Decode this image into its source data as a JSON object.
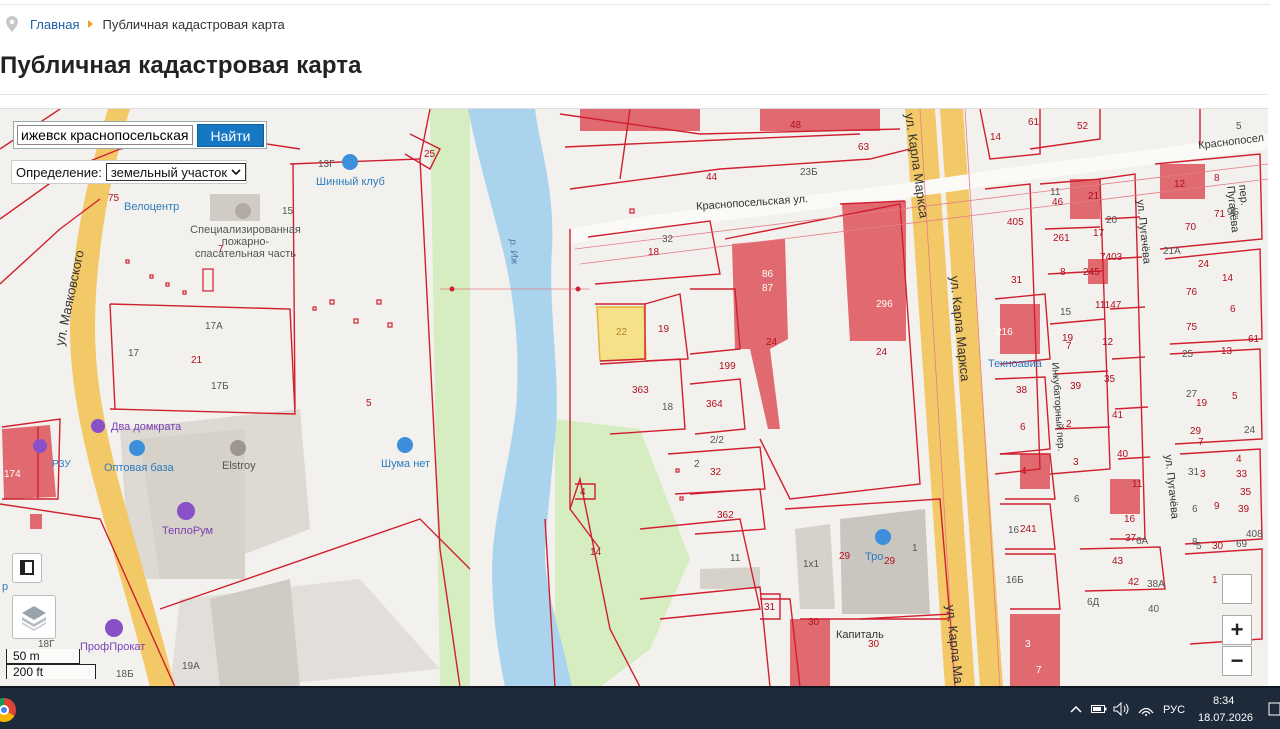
{
  "breadcrumb": {
    "home": "Главная",
    "current": "Публичная кадастровая карта"
  },
  "page_title": "Публичная кадастровая карта",
  "search": {
    "value": "ижевск краснопосельская 22",
    "button": "Найти"
  },
  "definition": {
    "label": "Определение:",
    "selected": "земельный участок"
  },
  "map_labels": {
    "street_marx_1": "ул. Карла Маркса",
    "street_marx_2": "ул. Карла Маркса",
    "street_marx_3": "ул. Карла Ма",
    "street_maiakovskogo": "ул. Маяковского",
    "street_krasnoposelskaya": "Краснопосельская ул.",
    "street_krasnoposel_right": "Краснопосел",
    "street_pugacheva": "ул. Пугачёва",
    "street_pugacheva_2": "ул. Пугачёва",
    "street_pugacheva_3": "пер. Пугачёва",
    "pereulok_inkubator": "Инкубаторный пер.",
    "river": "р. Иж",
    "poi_shinny": "Шинный клуб",
    "poi_velocentr": "Велоцентр",
    "poi_fire": "Специализированная пожарно-спасательная часть",
    "poi_dva_domkrata": "Два домкрата",
    "poi_optovaya": "Оптовая база",
    "poi_elstroy": "Elstroy",
    "poi_shuma": "Шума нет",
    "poi_teplorum": "ТеплоРум",
    "poi_profprokat": "ПрофПрокат",
    "poi_tehnoavia": "Техноавиа",
    "poi_kapital": "Капиталь",
    "poi_tro": "Тро",
    "poi_rzu": "РЗУ",
    "poi_r": "р"
  },
  "parcel_numbers": [
    "22",
    "19",
    "18",
    "32",
    "363",
    "18",
    "364",
    "199",
    "2/2",
    "2",
    "32",
    "362",
    "11",
    "86",
    "87",
    "24",
    "296",
    "24",
    "44",
    "23Б",
    "48",
    "63",
    "14",
    "61",
    "52",
    "13Г",
    "25",
    "15",
    "7",
    "17А",
    "17",
    "21",
    "17Б",
    "5",
    "75",
    "174",
    "19А",
    "18Г",
    "18Б",
    "4",
    "14",
    "1х1",
    "29",
    "29",
    "1",
    "30",
    "30",
    "31",
    "405",
    "31",
    "216",
    "38",
    "6",
    "4",
    "241",
    "16",
    "16Б",
    "11",
    "46",
    "21",
    "261",
    "17",
    "20",
    "8",
    "7403",
    "245",
    "11147",
    "15",
    "12",
    "19",
    "7",
    "39",
    "35",
    "2",
    "3",
    "41",
    "40",
    "6",
    "11",
    "16",
    "37",
    "42",
    "43",
    "38А",
    "40",
    "6Д",
    "5",
    "6А",
    "12",
    "8",
    "70",
    "71",
    "9Б",
    "21А",
    "24",
    "14",
    "76",
    "75",
    "6",
    "25",
    "13",
    "61",
    "27",
    "5",
    "19",
    "29",
    "7",
    "24",
    "31",
    "3",
    "4",
    "33",
    "6",
    "9",
    "35",
    "8",
    "30",
    "39",
    "5",
    "408",
    "69",
    "1",
    "2",
    "3",
    "7"
  ],
  "scale": {
    "metric": "50 m",
    "imperial": "200 ft"
  },
  "zoom": {
    "plus": "+",
    "minus": "−"
  },
  "taskbar": {
    "lang": "РУС",
    "time": "8:34",
    "date": "18.07.2026"
  },
  "colors": {
    "parcel_border": "#d02030",
    "building": "#e06a6f",
    "selected_parcel": "#f6e08a",
    "river": "#aad3ee",
    "road_major": "#f3c867",
    "green": "#d6ecc1"
  }
}
